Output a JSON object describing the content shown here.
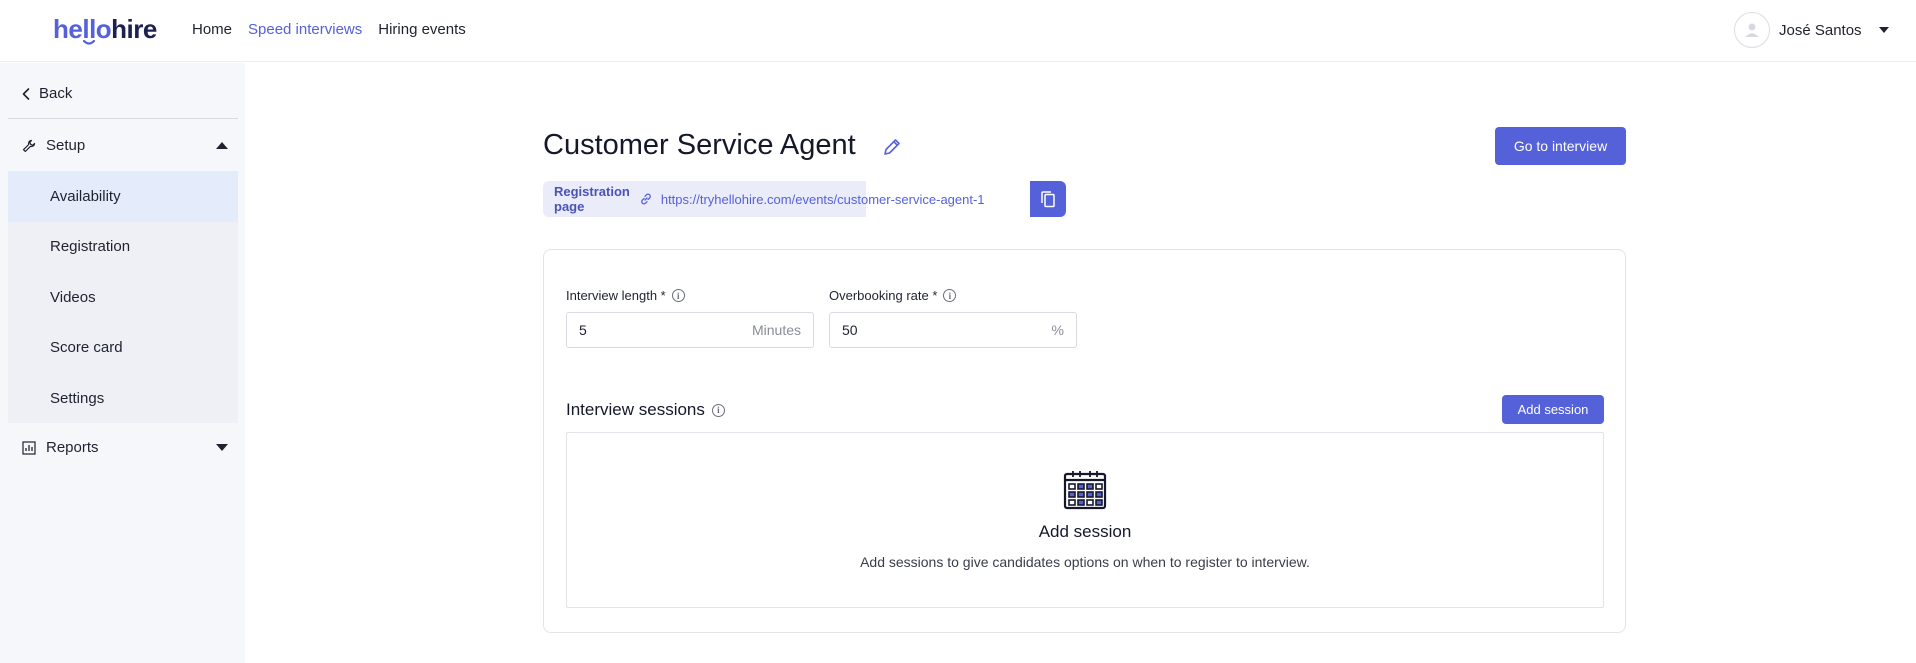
{
  "brand": {
    "logo_hello": "hello",
    "logo_hire": "hire",
    "accent": "#5561d8",
    "dark": "#1c2150"
  },
  "nav": {
    "home": "Home",
    "speed_interviews": "Speed interviews",
    "hiring_events": "Hiring events",
    "active": "Speed interviews"
  },
  "user": {
    "name": "José Santos",
    "avatar_icon": "user-avatar-icon"
  },
  "sidebar": {
    "back": "Back",
    "setup": {
      "label": "Setup",
      "expanded": true,
      "icon": "wrench-icon"
    },
    "items": [
      {
        "label": "Availability",
        "active": true
      },
      {
        "label": "Registration"
      },
      {
        "label": "Videos"
      },
      {
        "label": "Score card"
      },
      {
        "label": "Settings"
      }
    ],
    "reports": {
      "label": "Reports",
      "expanded": false,
      "icon": "bar-chart-icon"
    }
  },
  "page": {
    "title": "Customer Service Agent",
    "go_button": "Go to interview",
    "registration_label": "Registration page",
    "registration_url": "https://tryhellohire.com/events/customer-service-agent-1"
  },
  "form": {
    "interview_length": {
      "label": "Interview length *",
      "value": "5",
      "suffix": "Minutes"
    },
    "overbooking_rate": {
      "label": "Overbooking rate *",
      "value": "50",
      "suffix": "%"
    }
  },
  "sessions": {
    "title": "Interview sessions",
    "add_button": "Add session",
    "empty_title": "Add session",
    "empty_description": "Add sessions to give candidates options on when to register to interview."
  }
}
